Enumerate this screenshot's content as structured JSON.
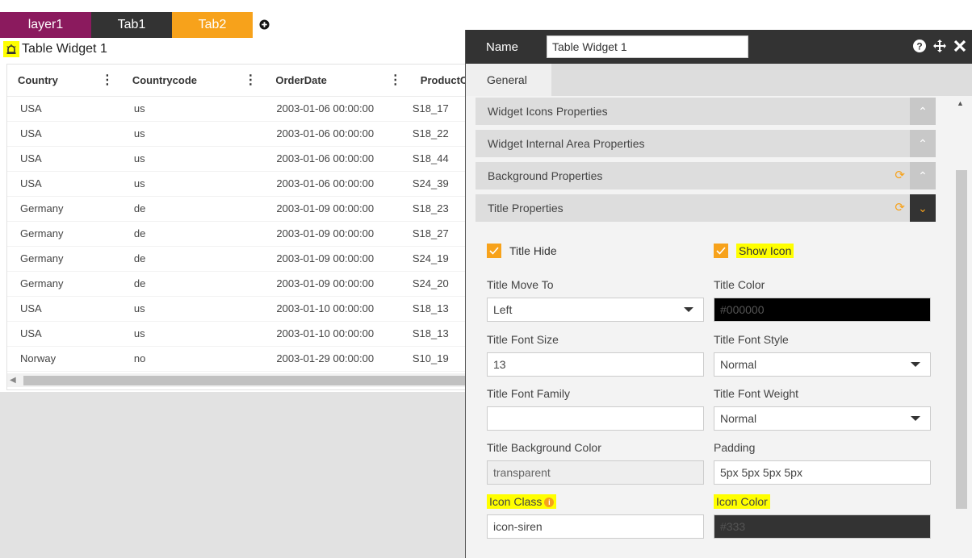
{
  "tabs": [
    {
      "label": "layer1"
    },
    {
      "label": "Tab1"
    },
    {
      "label": "Tab2"
    }
  ],
  "widget": {
    "title": "Table Widget 1",
    "icon": "siren-icon"
  },
  "table": {
    "columns": [
      "Country",
      "Countrycode",
      "OrderDate",
      "ProductC"
    ],
    "rows": [
      [
        "USA",
        "us",
        "2003-01-06 00:00:00",
        "S18_17"
      ],
      [
        "USA",
        "us",
        "2003-01-06 00:00:00",
        "S18_22"
      ],
      [
        "USA",
        "us",
        "2003-01-06 00:00:00",
        "S18_44"
      ],
      [
        "USA",
        "us",
        "2003-01-06 00:00:00",
        "S24_39"
      ],
      [
        "Germany",
        "de",
        "2003-01-09 00:00:00",
        "S18_23"
      ],
      [
        "Germany",
        "de",
        "2003-01-09 00:00:00",
        "S18_27"
      ],
      [
        "Germany",
        "de",
        "2003-01-09 00:00:00",
        "S24_19"
      ],
      [
        "Germany",
        "de",
        "2003-01-09 00:00:00",
        "S24_20"
      ],
      [
        "USA",
        "us",
        "2003-01-10 00:00:00",
        "S18_13"
      ],
      [
        "USA",
        "us",
        "2003-01-10 00:00:00",
        "S18_13"
      ],
      [
        "Norway",
        "no",
        "2003-01-29 00:00:00",
        "S10_19"
      ]
    ]
  },
  "panel": {
    "name_label": "Name",
    "name_value": "Table Widget 1",
    "subtab": "General",
    "sections": [
      {
        "label": "Widget Icons Properties"
      },
      {
        "label": "Widget Internal Area Properties"
      },
      {
        "label": "Background Properties"
      },
      {
        "label": "Title Properties"
      }
    ],
    "form": {
      "title_hide": "Title Hide",
      "show_icon": "Show Icon",
      "title_move_to": {
        "label": "Title Move To",
        "value": "Left"
      },
      "title_color": {
        "label": "Title Color",
        "value": "#000000"
      },
      "title_font_size": {
        "label": "Title Font Size",
        "value": "13"
      },
      "title_font_style": {
        "label": "Title Font Style",
        "value": "Normal"
      },
      "title_font_family": {
        "label": "Title Font Family",
        "value": ""
      },
      "title_font_weight": {
        "label": "Title Font Weight",
        "value": "Normal"
      },
      "title_bg_color": {
        "label": "Title Background Color",
        "value": "transparent"
      },
      "padding": {
        "label": "Padding",
        "value": "5px 5px 5px 5px"
      },
      "icon_class": {
        "label": "Icon Class",
        "value": "icon-siren"
      },
      "icon_color": {
        "label": "Icon Color",
        "value": "#333"
      }
    }
  },
  "colors": {
    "accent": "#f7a21b",
    "layer_tab": "#8b1a5e",
    "dark": "#333333",
    "highlight": "#ffff00"
  }
}
